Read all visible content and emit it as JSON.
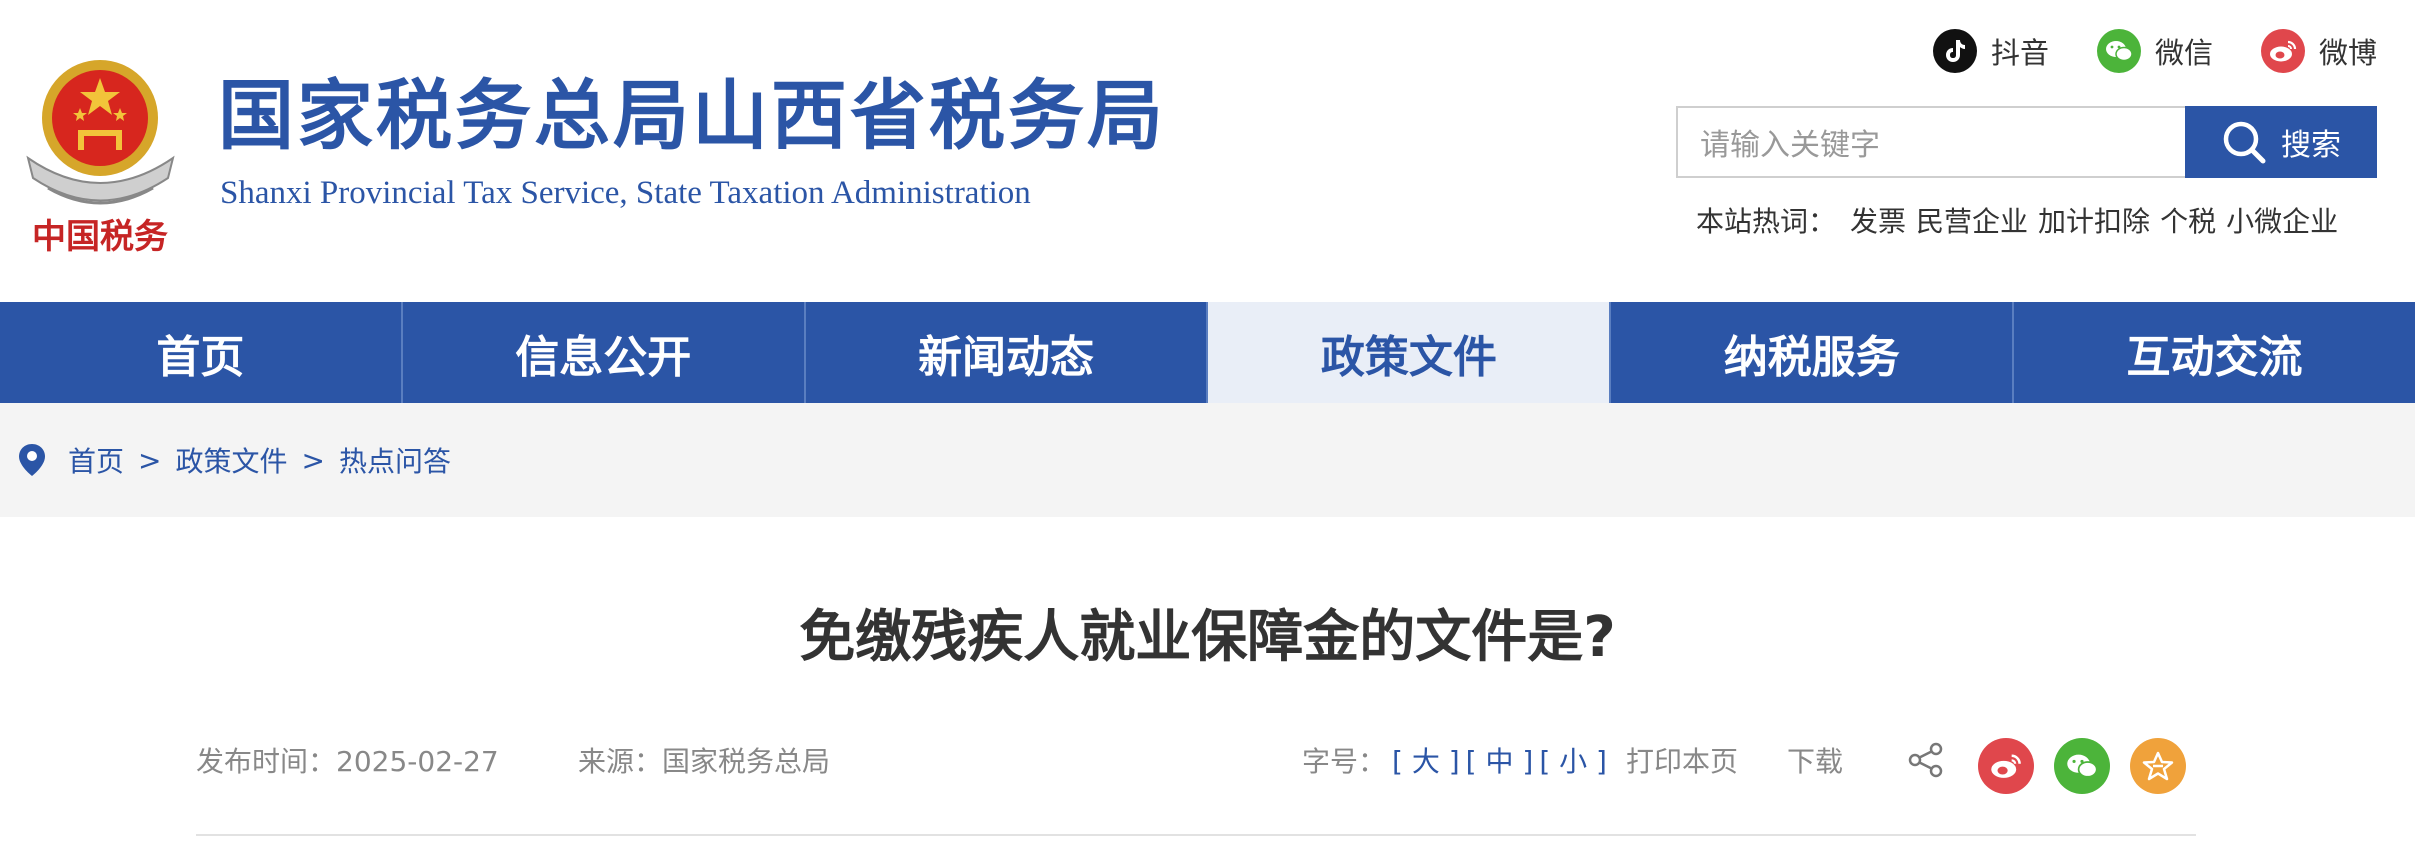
{
  "header": {
    "title_cn": "国家税务总局山西省税务局",
    "title_en": "Shanxi Provincial Tax Service, State Taxation Administration",
    "emblem_text": "中国税务"
  },
  "social": {
    "douyin": "抖音",
    "wechat": "微信",
    "weibo": "微博"
  },
  "search": {
    "placeholder": "请输入关键字",
    "button_label": "搜索"
  },
  "hotwords": {
    "label": "本站热词：",
    "items": [
      "发票",
      "民营企业",
      "加计扣除",
      "个税",
      "小微企业"
    ]
  },
  "nav": {
    "items": [
      "首页",
      "信息公开",
      "新闻动态",
      "政策文件",
      "纳税服务",
      "互动交流"
    ],
    "active": "政策文件"
  },
  "breadcrumb": {
    "items": [
      "首页",
      "政策文件",
      "热点问答"
    ],
    "separator": ">"
  },
  "article": {
    "title": "免缴残疾人就业保障金的文件是?",
    "date_label": "发布时间：",
    "date": "2025-02-27",
    "source_label": "来源：",
    "source": "国家税务总局",
    "font_label": "字号：",
    "font_large": "[ 大 ]",
    "font_medium": "[ 中 ]",
    "font_small": "[ 小 ]",
    "print": "打印本页",
    "download": "下载"
  },
  "colors": {
    "brand": "#2b55a6",
    "weibo": "#e0474c",
    "wechat": "#4cb43a",
    "favorite": "#f0a23b"
  },
  "icons": [
    "douyin-icon",
    "wechat-icon",
    "weibo-icon",
    "search-icon",
    "location-pin-icon",
    "share-icon",
    "star-icon"
  ]
}
